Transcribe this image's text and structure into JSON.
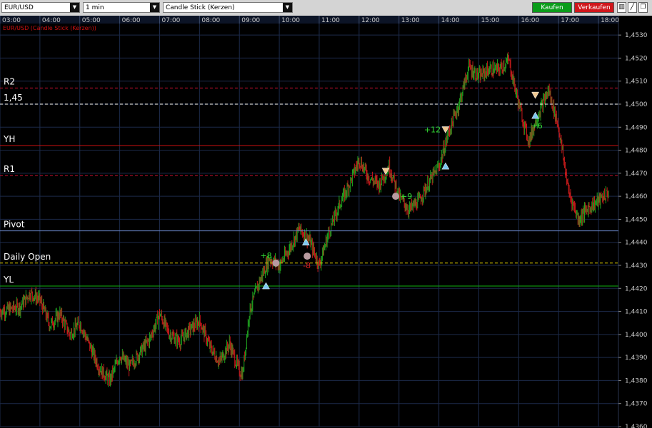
{
  "toolbar": {
    "symbol": "EUR/USD",
    "interval": "1 min",
    "chart_type": "Candle Stick (Kerzen)",
    "buy_label": "Kaufen",
    "sell_label": "Verkaufen",
    "icons": [
      "bar-chart-icon",
      "draw-line-icon",
      "window-icon"
    ]
  },
  "colors": {
    "background": "#000000",
    "grid": "#1c2a4a",
    "up_candle": "#1fa01f",
    "down_candle": "#c41a1a",
    "buy_button": "#0a9c1a",
    "sell_button": "#d0161b",
    "r_levels": "#c8102e",
    "yh": "#d01212",
    "pivot": "#6a86c8",
    "daily_open": "#e0d000",
    "yl": "#10b010",
    "round_number": "#ffffff"
  },
  "chart_data": {
    "type": "candlestick",
    "title": "EUR/USD (Candle Stick (Kerzen))",
    "x_ticks": [
      "03:00",
      "04:00",
      "05:00",
      "06:00",
      "07:00",
      "08:00",
      "09:00",
      "10:00",
      "11:00",
      "12:00",
      "13:00",
      "14:00",
      "15:00",
      "16:00",
      "17:00",
      "18:00"
    ],
    "y_ticks": [
      "1,4360",
      "1,4370",
      "1,4380",
      "1,4390",
      "1,4400",
      "1,4410",
      "1,4420",
      "1,4430",
      "1,4440",
      "1,4450",
      "1,4460",
      "1,4470",
      "1,4480",
      "1,4490",
      "1,4500",
      "1,4510",
      "1,4520",
      "1,4530"
    ],
    "ylim": [
      1.436,
      1.4535
    ],
    "xlim": [
      "03:00",
      "18:30"
    ],
    "price_path": [
      [
        "03:00",
        1.441
      ],
      [
        "03:30",
        1.4412
      ],
      [
        "03:45",
        1.4418
      ],
      [
        "04:00",
        1.4415
      ],
      [
        "04:15",
        1.4404
      ],
      [
        "04:30",
        1.4409
      ],
      [
        "04:45",
        1.44
      ],
      [
        "05:00",
        1.4405
      ],
      [
        "05:15",
        1.4395
      ],
      [
        "05:30",
        1.4385
      ],
      [
        "05:45",
        1.438
      ],
      [
        "06:00",
        1.4391
      ],
      [
        "06:15",
        1.4386
      ],
      [
        "06:30",
        1.4392
      ],
      [
        "06:45",
        1.4398
      ],
      [
        "07:00",
        1.4409
      ],
      [
        "07:15",
        1.44
      ],
      [
        "07:30",
        1.4397
      ],
      [
        "07:45",
        1.4402
      ],
      [
        "08:00",
        1.4406
      ],
      [
        "08:15",
        1.4395
      ],
      [
        "08:30",
        1.4388
      ],
      [
        "08:45",
        1.4396
      ],
      [
        "09:00",
        1.4384
      ],
      [
        "09:05",
        1.4383
      ],
      [
        "09:15",
        1.441
      ],
      [
        "09:30",
        1.4423
      ],
      [
        "09:45",
        1.4433
      ],
      [
        "10:00",
        1.443
      ],
      [
        "10:15",
        1.4437
      ],
      [
        "10:30",
        1.4446
      ],
      [
        "10:45",
        1.4441
      ],
      [
        "11:00",
        1.443
      ],
      [
        "11:15",
        1.4445
      ],
      [
        "11:30",
        1.4456
      ],
      [
        "11:45",
        1.4465
      ],
      [
        "12:00",
        1.4476
      ],
      [
        "12:15",
        1.4468
      ],
      [
        "12:30",
        1.4465
      ],
      [
        "12:45",
        1.4473
      ],
      [
        "13:00",
        1.446
      ],
      [
        "13:15",
        1.4454
      ],
      [
        "13:30",
        1.4458
      ],
      [
        "13:45",
        1.4466
      ],
      [
        "14:00",
        1.4473
      ],
      [
        "14:15",
        1.4488
      ],
      [
        "14:30",
        1.45
      ],
      [
        "14:45",
        1.4516
      ],
      [
        "15:00",
        1.4512
      ],
      [
        "15:15",
        1.4515
      ],
      [
        "15:30",
        1.4515
      ],
      [
        "15:45",
        1.4519
      ],
      [
        "16:00",
        1.45
      ],
      [
        "16:15",
        1.4484
      ],
      [
        "16:30",
        1.4496
      ],
      [
        "16:45",
        1.4506
      ],
      [
        "17:00",
        1.449
      ],
      [
        "17:15",
        1.4462
      ],
      [
        "17:30",
        1.445
      ],
      [
        "17:45",
        1.4455
      ],
      [
        "18:00",
        1.4458
      ],
      [
        "18:15",
        1.4462
      ]
    ],
    "levels": [
      {
        "name": "R2",
        "value": 1.4507,
        "style": "dashed",
        "color": "#c8102e"
      },
      {
        "name": "1,45",
        "value": 1.45,
        "style": "dashed",
        "color": "#ffffff"
      },
      {
        "name": "YH",
        "value": 1.4482,
        "style": "solid",
        "color": "#d01212"
      },
      {
        "name": "R1",
        "value": 1.4469,
        "style": "dashed",
        "color": "#c8102e"
      },
      {
        "name": "Pivot",
        "value": 1.4445,
        "style": "solid",
        "color": "#6a86c8"
      },
      {
        "name": "Daily Open",
        "value": 1.4431,
        "style": "dashed",
        "color": "#e0d000"
      },
      {
        "name": "YL",
        "value": 1.4421,
        "style": "solid",
        "color": "#10b010"
      }
    ],
    "markers": [
      {
        "time": "09:40",
        "price": 1.4421,
        "kind": "buy"
      },
      {
        "time": "09:55",
        "price": 1.4431,
        "kind": "exit",
        "label": "+8",
        "label_color": "#33dd33"
      },
      {
        "time": "10:40",
        "price": 1.444,
        "kind": "buy"
      },
      {
        "time": "10:42",
        "price": 1.4434,
        "kind": "exit",
        "label": "-8",
        "label_color": "#e02020"
      },
      {
        "time": "12:40",
        "price": 1.4471,
        "kind": "sell"
      },
      {
        "time": "12:55",
        "price": 1.446,
        "kind": "exit",
        "label": "+9",
        "label_color": "#33dd33"
      },
      {
        "time": "14:10",
        "price": 1.4473,
        "kind": "buy"
      },
      {
        "time": "14:10",
        "price": 1.4489,
        "kind": "sell",
        "label": "+12",
        "label_color": "#33dd33"
      },
      {
        "time": "16:25",
        "price": 1.4504,
        "kind": "sell"
      },
      {
        "time": "16:25",
        "price": 1.4495,
        "kind": "buy",
        "label": "+6",
        "label_color": "#33dd33"
      }
    ]
  }
}
